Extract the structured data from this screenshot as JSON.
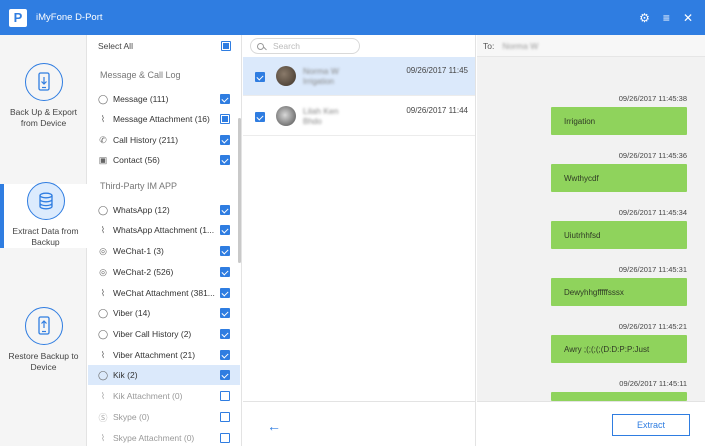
{
  "app": {
    "title": "iMyFone D-Port",
    "logo_letter": "P"
  },
  "window_controls": {
    "settings": "⚙",
    "menu": "≡",
    "close": "✕"
  },
  "nav": [
    {
      "label_line1": "Back Up & Export",
      "label_line2": "from Device",
      "icon": "phone-export-icon",
      "active": false
    },
    {
      "label_line1": "Extract Data from",
      "label_line2": "Backup",
      "icon": "database-icon",
      "active": true
    },
    {
      "label_line1": "Restore Backup to",
      "label_line2": "Device",
      "icon": "phone-restore-icon",
      "active": false
    }
  ],
  "categories": {
    "select_all": "Select All",
    "group1_title": "Message & Call Log",
    "group2_title": "Third-Party IM APP",
    "items": [
      {
        "label": "Message (111)",
        "icon": "chat-bubble-icon",
        "state": "on"
      },
      {
        "label": "Message Attachment (16)",
        "icon": "paperclip-icon",
        "state": "part"
      },
      {
        "label": "Call History (211)",
        "icon": "phone-icon",
        "state": "on"
      },
      {
        "label": "Contact (56)",
        "icon": "contact-card-icon",
        "state": "on"
      },
      {
        "label": "WhatsApp (12)",
        "icon": "whatsapp-icon",
        "state": "on"
      },
      {
        "label": "WhatsApp Attachment (1...",
        "icon": "paperclip-icon",
        "state": "on"
      },
      {
        "label": "WeChat-1 (3)",
        "icon": "wechat-icon",
        "state": "on"
      },
      {
        "label": "WeChat-2 (526)",
        "icon": "wechat-icon",
        "state": "on"
      },
      {
        "label": "WeChat Attachment (381...",
        "icon": "paperclip-icon",
        "state": "on"
      },
      {
        "label": "Viber (14)",
        "icon": "viber-icon",
        "state": "on"
      },
      {
        "label": "Viber Call History (2)",
        "icon": "viber-icon",
        "state": "on"
      },
      {
        "label": "Viber Attachment (21)",
        "icon": "paperclip-icon",
        "state": "on"
      },
      {
        "label": "Kik (2)",
        "icon": "kik-icon",
        "state": "on",
        "highlight": true
      },
      {
        "label": "Kik Attachment (0)",
        "icon": "paperclip-icon",
        "state": "off",
        "dim": true
      },
      {
        "label": "Skype (0)",
        "icon": "skype-icon",
        "state": "off",
        "dim": true
      },
      {
        "label": "Skype Attachment (0)",
        "icon": "paperclip-icon",
        "state": "off",
        "dim": true
      }
    ]
  },
  "search": {
    "placeholder": "Search"
  },
  "conversations": [
    {
      "name": "Norma W",
      "sub": "Irrigation",
      "date": "09/26/2017 11:45",
      "selected": true
    },
    {
      "name": "Lilah Ken",
      "sub": "Bhdo",
      "date": "09/26/2017 11:44",
      "selected": false
    }
  ],
  "chat": {
    "to_label": "To:",
    "to_name": "Norma W",
    "messages": [
      {
        "time": "09/26/2017 11:45:38",
        "text": "Irrigation"
      },
      {
        "time": "09/26/2017 11:45:36",
        "text": "Wwthycdf"
      },
      {
        "time": "09/26/2017 11:45:34",
        "text": "Uiutrhhfsd"
      },
      {
        "time": "09/26/2017 11:45:31",
        "text": "Dewyhhgfffffsssx"
      },
      {
        "time": "09/26/2017 11:45:21",
        "text": "Awry ;(;(;(;(D:D:P:P:Just"
      },
      {
        "time": "09/26/2017 11:45:11",
        "text": ""
      }
    ]
  },
  "footer": {
    "back": "←",
    "extract": "Extract"
  },
  "colors": {
    "accent": "#2f7de1",
    "bubble": "#8fd35c"
  }
}
